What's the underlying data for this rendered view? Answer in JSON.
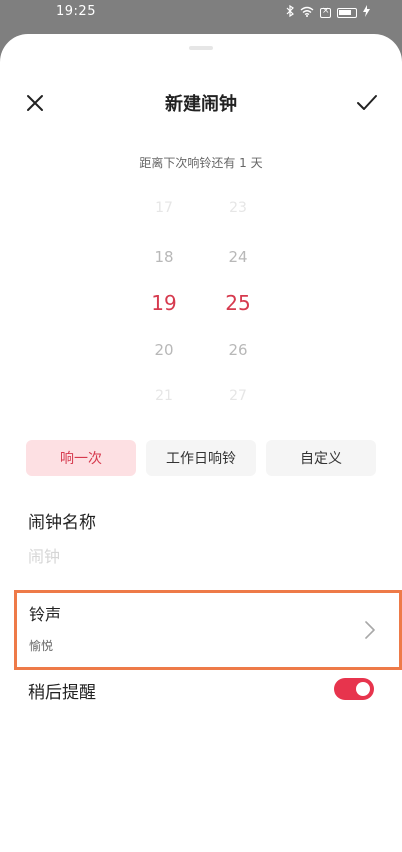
{
  "status_bar": {
    "time": "19:25",
    "icons": [
      "bluetooth-icon",
      "wifi-icon",
      "sim-icon",
      "battery-icon",
      "charging-icon"
    ]
  },
  "header": {
    "title": "新建闹钟",
    "close_icon": "close-icon",
    "confirm_icon": "check-icon"
  },
  "countdown_text": "距离下次响铃还有 1 天",
  "time_picker": {
    "hours": [
      "17",
      "18",
      "19",
      "20",
      "21"
    ],
    "minutes": [
      "23",
      "24",
      "25",
      "26",
      "27"
    ],
    "selected_hour": "19",
    "selected_minute": "25"
  },
  "repeat": {
    "options": [
      "响一次",
      "工作日响铃",
      "自定义"
    ],
    "selected": "响一次"
  },
  "alarm_name": {
    "label": "闹钟名称",
    "placeholder": "闹钟",
    "value": ""
  },
  "ringtone": {
    "label": "铃声",
    "value": "愉悦"
  },
  "snooze": {
    "label": "稍后提醒",
    "enabled": true
  },
  "colors": {
    "accent": "#d63a4e",
    "toggle_on": "#e7344d",
    "highlight_border": "#ee7a48",
    "selected_chip_bg": "#fde0e3"
  }
}
